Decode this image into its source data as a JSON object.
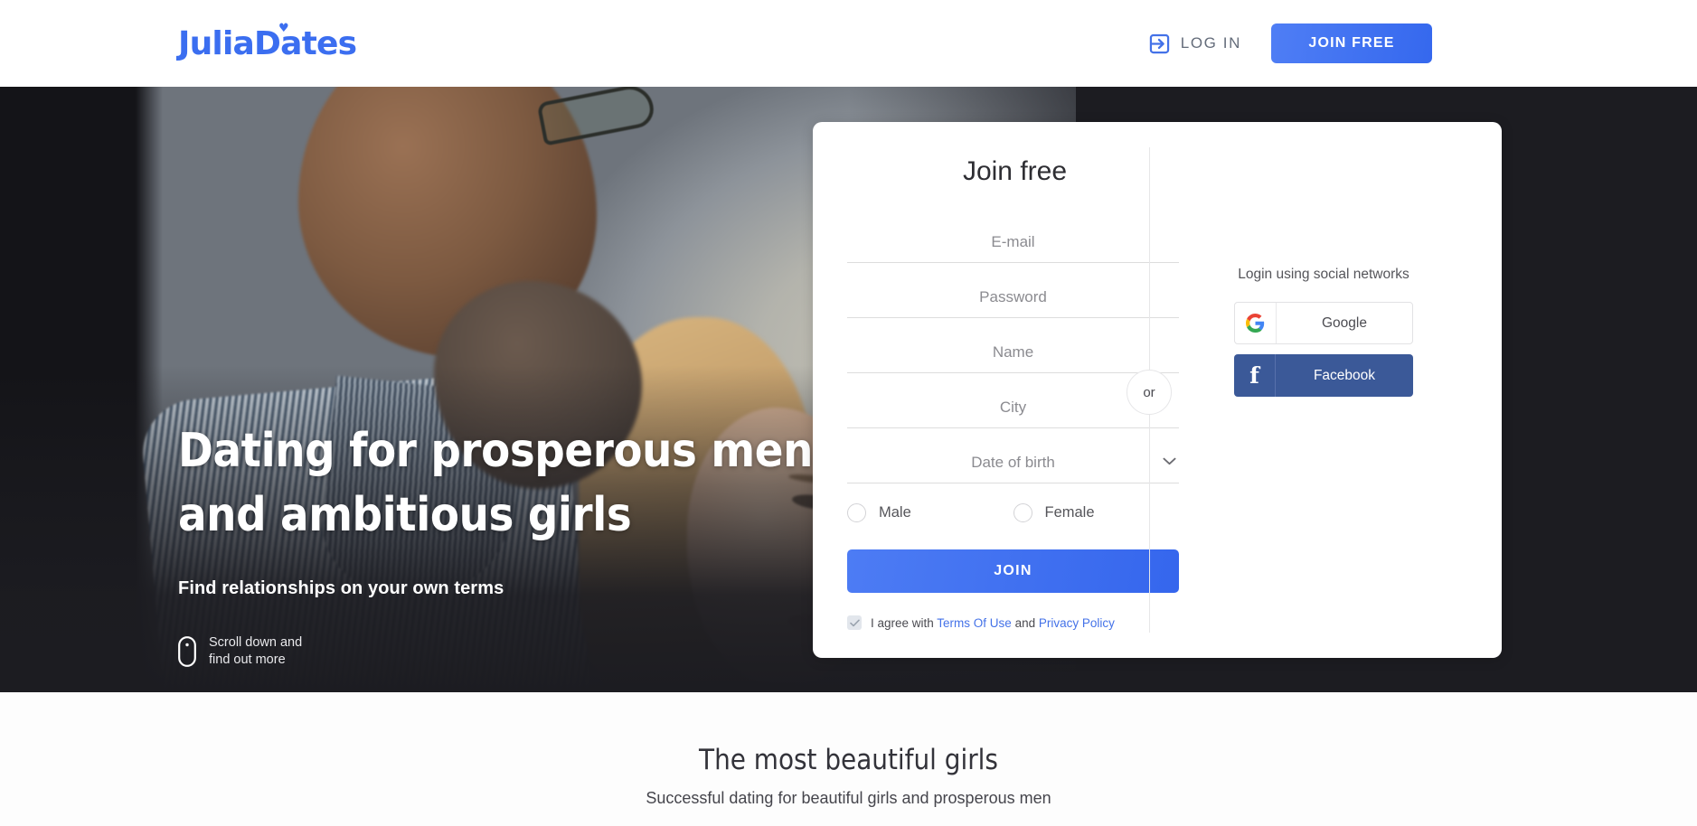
{
  "header": {
    "logo_text": "JuliaDates",
    "logo_color": "#3b6ef0",
    "login_label": "LOG IN",
    "login_icon": "login-arrow-icon",
    "join_free_label": "JOIN FREE"
  },
  "hero": {
    "title_line1": "Dating for prosperous men",
    "title_line2": "and ambitious girls",
    "subtitle": "Find relationships on your own terms",
    "scroll_hint": "Scroll down and\nfind out more",
    "scroll_icon": "mouse-icon"
  },
  "join_card": {
    "title": "Join free",
    "fields": [
      {
        "name": "email",
        "placeholder": "E-mail",
        "value": "",
        "type": "email"
      },
      {
        "name": "password",
        "placeholder": "Password",
        "value": "",
        "type": "password"
      },
      {
        "name": "name",
        "placeholder": "Name",
        "value": "",
        "type": "text"
      },
      {
        "name": "city",
        "placeholder": "City",
        "value": "",
        "type": "text"
      }
    ],
    "dob": {
      "placeholder": "Date of birth",
      "value": "",
      "chevron_icon": "chevron-down-icon"
    },
    "gender": {
      "male_label": "Male",
      "female_label": "Female",
      "selected": ""
    },
    "submit_label": "JOIN",
    "terms": {
      "checked": true,
      "prefix": "I agree with ",
      "terms_link": "Terms Of Use",
      "middle": " and ",
      "privacy_link": "Privacy Policy"
    },
    "divider_label": "or",
    "social": {
      "caption": "Login using social networks",
      "google_label": "Google",
      "google_icon": "google-icon",
      "facebook_label": "Facebook",
      "facebook_icon": "facebook-icon",
      "facebook_color": "#3b5998"
    },
    "accent_color": "#3b6ef0"
  },
  "section": {
    "title": "The most beautiful girls",
    "subtitle": "Successful dating for beautiful girls and prosperous men"
  }
}
